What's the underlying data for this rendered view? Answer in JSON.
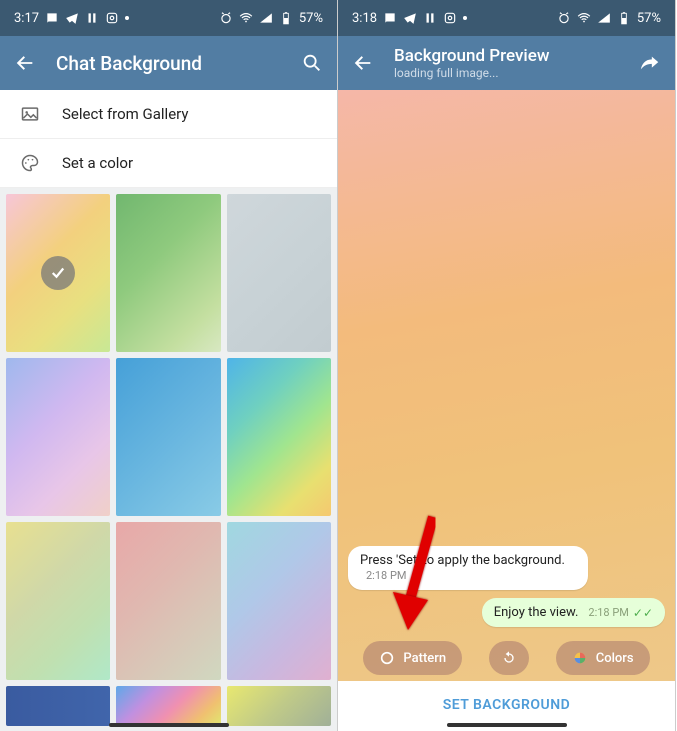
{
  "left": {
    "status": {
      "time": "3:17",
      "battery": "57%"
    },
    "appbar": {
      "title": "Chat Background"
    },
    "options": {
      "gallery": "Select from Gallery",
      "color": "Set a color"
    }
  },
  "right": {
    "status": {
      "time": "3:18",
      "battery": "57%"
    },
    "appbar": {
      "title": "Background Preview",
      "subtitle": "loading full image..."
    },
    "messages": {
      "in": {
        "text": "Press 'Set' to apply the background.",
        "time": "2:18 PM"
      },
      "out": {
        "text": "Enjoy the view.",
        "time": "2:18 PM"
      }
    },
    "chips": {
      "pattern": "Pattern",
      "colors": "Colors"
    },
    "setButton": "SET BACKGROUND"
  },
  "wallpapers": {
    "w1": "linear-gradient(135deg,#f7c6d8 0%,#f3d07e 40%,#e8e080 70%,#c8e895 100%)",
    "w2": "linear-gradient(135deg,#71b76f 0%,#8fca7e 40%,#c4dfa0 80%,#d8e8c2 100%)",
    "w3": "linear-gradient(135deg,#cfd7db 0%,#c8d2d6 50%,#c2ccd0 100%)",
    "w4": "linear-gradient(135deg,#9fb8ed 0%,#d0b8f0 40%,#e8c6e8 70%,#f0d0c8 100%)",
    "w5": "linear-gradient(135deg,#46a0d8 0%,#67b5df 50%,#89cbe6 100%)",
    "w6": "linear-gradient(135deg,#4fb4e8 0%,#6fd0c0 30%,#a0e58f 55%,#e8e070 80%,#f5c870 100%)",
    "w7": "linear-gradient(135deg,#e8e090 0%,#d0d8a8 40%,#c0e0b0 70%,#b0e8c8 100%)",
    "w8": "linear-gradient(135deg,#e8a8a8 0%,#e0b8b0 40%,#d8c8b8 70%,#d0d8c0 100%)",
    "w9": "linear-gradient(135deg,#a0d8e0 0%,#b0c8e8 40%,#c8b8e0 70%,#e0b0d0 100%)",
    "w10": "linear-gradient(90deg,#3a5ba0 0%,#4065ab 100%)",
    "w11": "linear-gradient(135deg,#5fa8e8 0%,#c090e0 30%,#f090b0 55%,#f0c070 80%,#e0e870 100%)",
    "w12": "linear-gradient(135deg,#e8e870 0%,#c0ca88 50%,#a0b098 100%)"
  }
}
